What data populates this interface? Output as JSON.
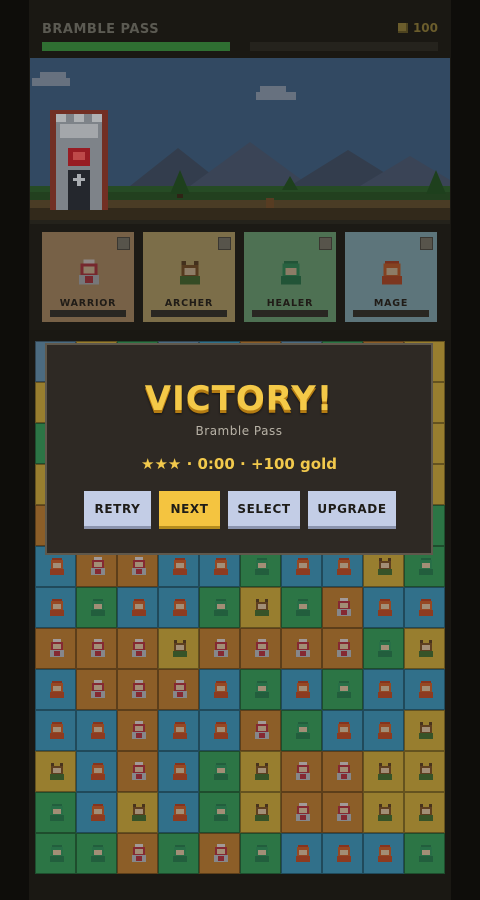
{
  "header": {
    "level_name": "BRAMBLE PASS",
    "gold": "100",
    "progress": 1.0
  },
  "colors": {
    "accent": "#f4c948",
    "progress": "#2f6f32",
    "warrior": "#e39b43",
    "archer": "#f0c74b",
    "healer": "#4fbf74",
    "mage": "#4fb7dc"
  },
  "heroes": [
    {
      "name": "WARRIOR",
      "icon": "warrior-icon"
    },
    {
      "name": "ARCHER",
      "icon": "archer-icon"
    },
    {
      "name": "HEALER",
      "icon": "healer-icon"
    },
    {
      "name": "MAGE",
      "icon": "mage-icon"
    }
  ],
  "board": {
    "cols": 10,
    "rows": 13,
    "grid": [
      "SAHSMWSHWA",
      "AWWHSASMSA",
      "HHWASWWSSA",
      "AWHWSMSSSA",
      "WSMMHSSMWH",
      "MWWMMHMMAH",
      "MHMMHAHWMM",
      "WWWAWWWWHA",
      "MWWWMHMHMM",
      "MMWMMWHMMA",
      "AMWMHAWWAA",
      "HMAMHAWWAA",
      "HHWHWHMMMH"
    ]
  },
  "modal": {
    "title": "VICTORY!",
    "subtitle": "Bramble Pass",
    "stats": "★★★ · 0:00 · +100 gold",
    "buttons": [
      {
        "label": "RETRY"
      },
      {
        "label": "NEXT"
      },
      {
        "label": "SELECT"
      },
      {
        "label": "UPGRADE"
      }
    ]
  }
}
